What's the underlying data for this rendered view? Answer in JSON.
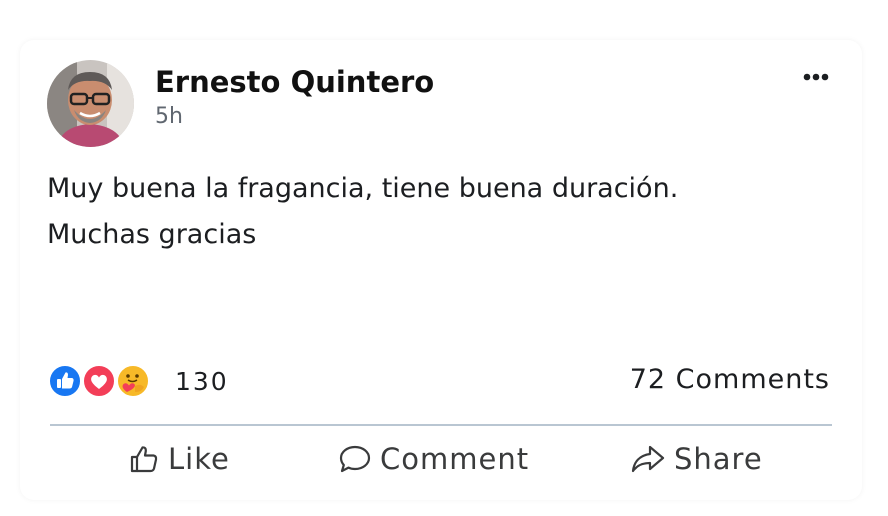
{
  "post": {
    "author": "Ernesto Quintero",
    "time": "5h",
    "text": "Muy buena la fragancia, tiene buena duración.\nMuchas gracias",
    "reactions": {
      "icons": [
        "like-icon",
        "love-icon",
        "care-icon"
      ],
      "count": "130"
    },
    "comments_label": "72 Comments",
    "actions": {
      "like": "Like",
      "comment": "Comment",
      "share": "Share"
    }
  },
  "colors": {
    "like_blue": "#1877f2",
    "love_red": "#f33e58",
    "care_yellow": "#f7b928",
    "divider": "#b9c6d2",
    "time_gray": "#606770"
  }
}
